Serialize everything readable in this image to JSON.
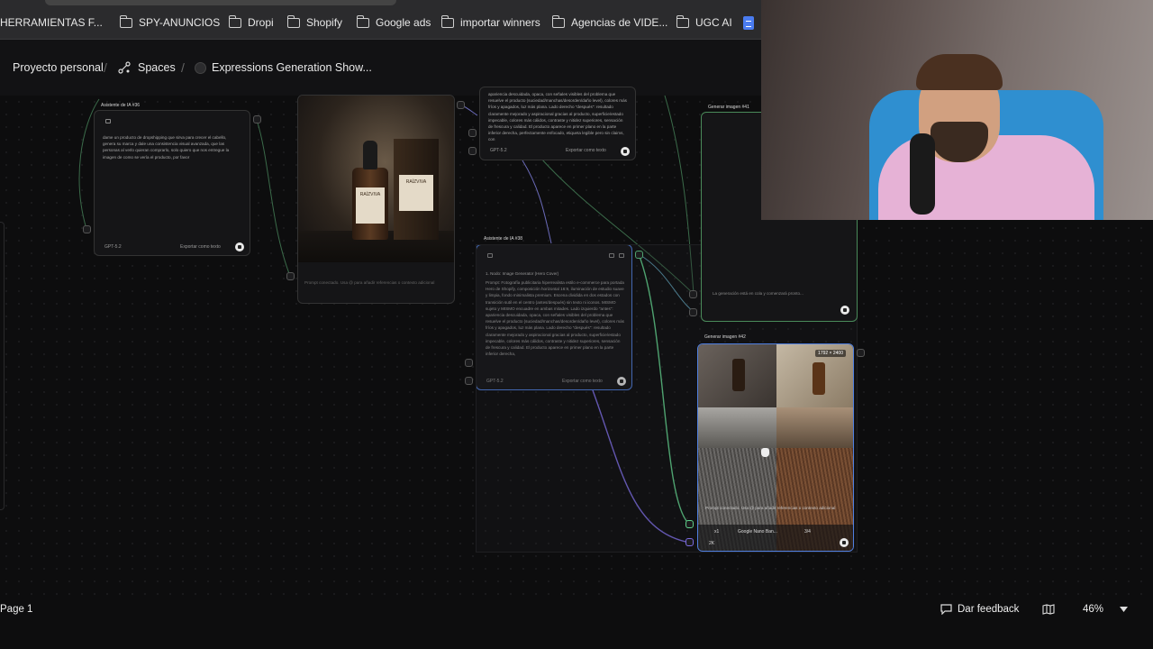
{
  "bookmarks": [
    {
      "label": "HERRAMIENTAS F...",
      "icon": "folder-icon"
    },
    {
      "label": "SPY-ANUNCIOS",
      "icon": "folder-icon"
    },
    {
      "label": "Dropi",
      "icon": "folder-icon"
    },
    {
      "label": "Shopify",
      "icon": "folder-icon"
    },
    {
      "label": "Google ads",
      "icon": "folder-icon"
    },
    {
      "label": "importar winners",
      "icon": "folder-icon"
    },
    {
      "label": "Agencias de VIDE...",
      "icon": "folder-icon"
    },
    {
      "label": "UGC AI",
      "icon": "folder-icon"
    }
  ],
  "breadcrumb": {
    "project": "Proyecto personal",
    "spaces": "Spaces",
    "page": "Expressions Generation Show..."
  },
  "nodes": {
    "assistant36": {
      "title": "Asistente de IA #36",
      "text": "dame un producto de dropshipping que sirva para crecer el cabello, genera su marca y dale una consistencia visual avanzada, que las personas al verlo quieran comprarlo, solo quiero que nos entregue la imagen de como se vería el producto, por favor",
      "model": "GPT-5.2",
      "export": "Exportar como texto"
    },
    "product": {
      "prompt_placeholder": "Prompt conectado. Usa @ para añadir referencias o contexto adicional",
      "brand": "RAÍZVIVA"
    },
    "topText": {
      "text": "apariencia descuidada, opaca, con señales visibles del problema que resuelve el producto (suciedad/manchas/desorden/daño level), colores más fríos y apagados, luz más plana. Lado derecho \"después\": resultado claramente mejorado y aspiracional gracias al producto, superficie/estado impecable, colores más cálidos, contraste y nitidez superiores, sensación de frescura y calidad. El producto aparece en primer plano en la parte inferior derecha, perfectamente enfocado, etiqueta legible pero sin claims, con",
      "model": "GPT-5.2",
      "export": "Exportar como texto"
    },
    "assistant38": {
      "title": "Asistente de IA #38",
      "heading": "1. Nodo: Image Generator (Hero Cover)",
      "text": "Prompt: Fotografía publicitaria hiperrealista estilo e-commerce para portada Hero de Shopify, composición horizontal 16:9, iluminación de estudio suave y limpia, fondo minimalista premium. Escena dividida en dos estados con transición sutil en el centro (antes/después) sin texto ni iconos. MISMO sujeto y MISMO encuadre en ambas mitades. Lado izquierdo \"antes\": apariencia descuidada, opaca, con señales visibles del problema que resuelve el producto (suciedad/manchas/desorden/daño level), colores más fríos y apagados, luz más plana. Lado derecho \"después\": resultado claramente mejorado y aspiracional gracias al producto, superficie/estado impecable, colores más cálidos, contraste y nitidez superiores, sensación de frescura y calidad. El producto aparece en primer plano en la parte inferior derecha,",
      "model": "GPT-5.2",
      "export": "Exportar como texto"
    },
    "gen41": {
      "title": "Generar imagen #41",
      "status": "La generación está en cola y comenzará pronto..."
    },
    "gen42": {
      "title": "Generar imagen #42",
      "size": "1792 × 2400",
      "overlay": "Prompt conectado. Usa @ para añadir referencias o contexto adicional",
      "model": "Google Nano Ban...",
      "count": "3/4",
      "res": "2K",
      "mult": "x1"
    }
  },
  "bottom": {
    "page": "Page 1",
    "feedback": "Dar feedback",
    "zoom": "46%"
  }
}
